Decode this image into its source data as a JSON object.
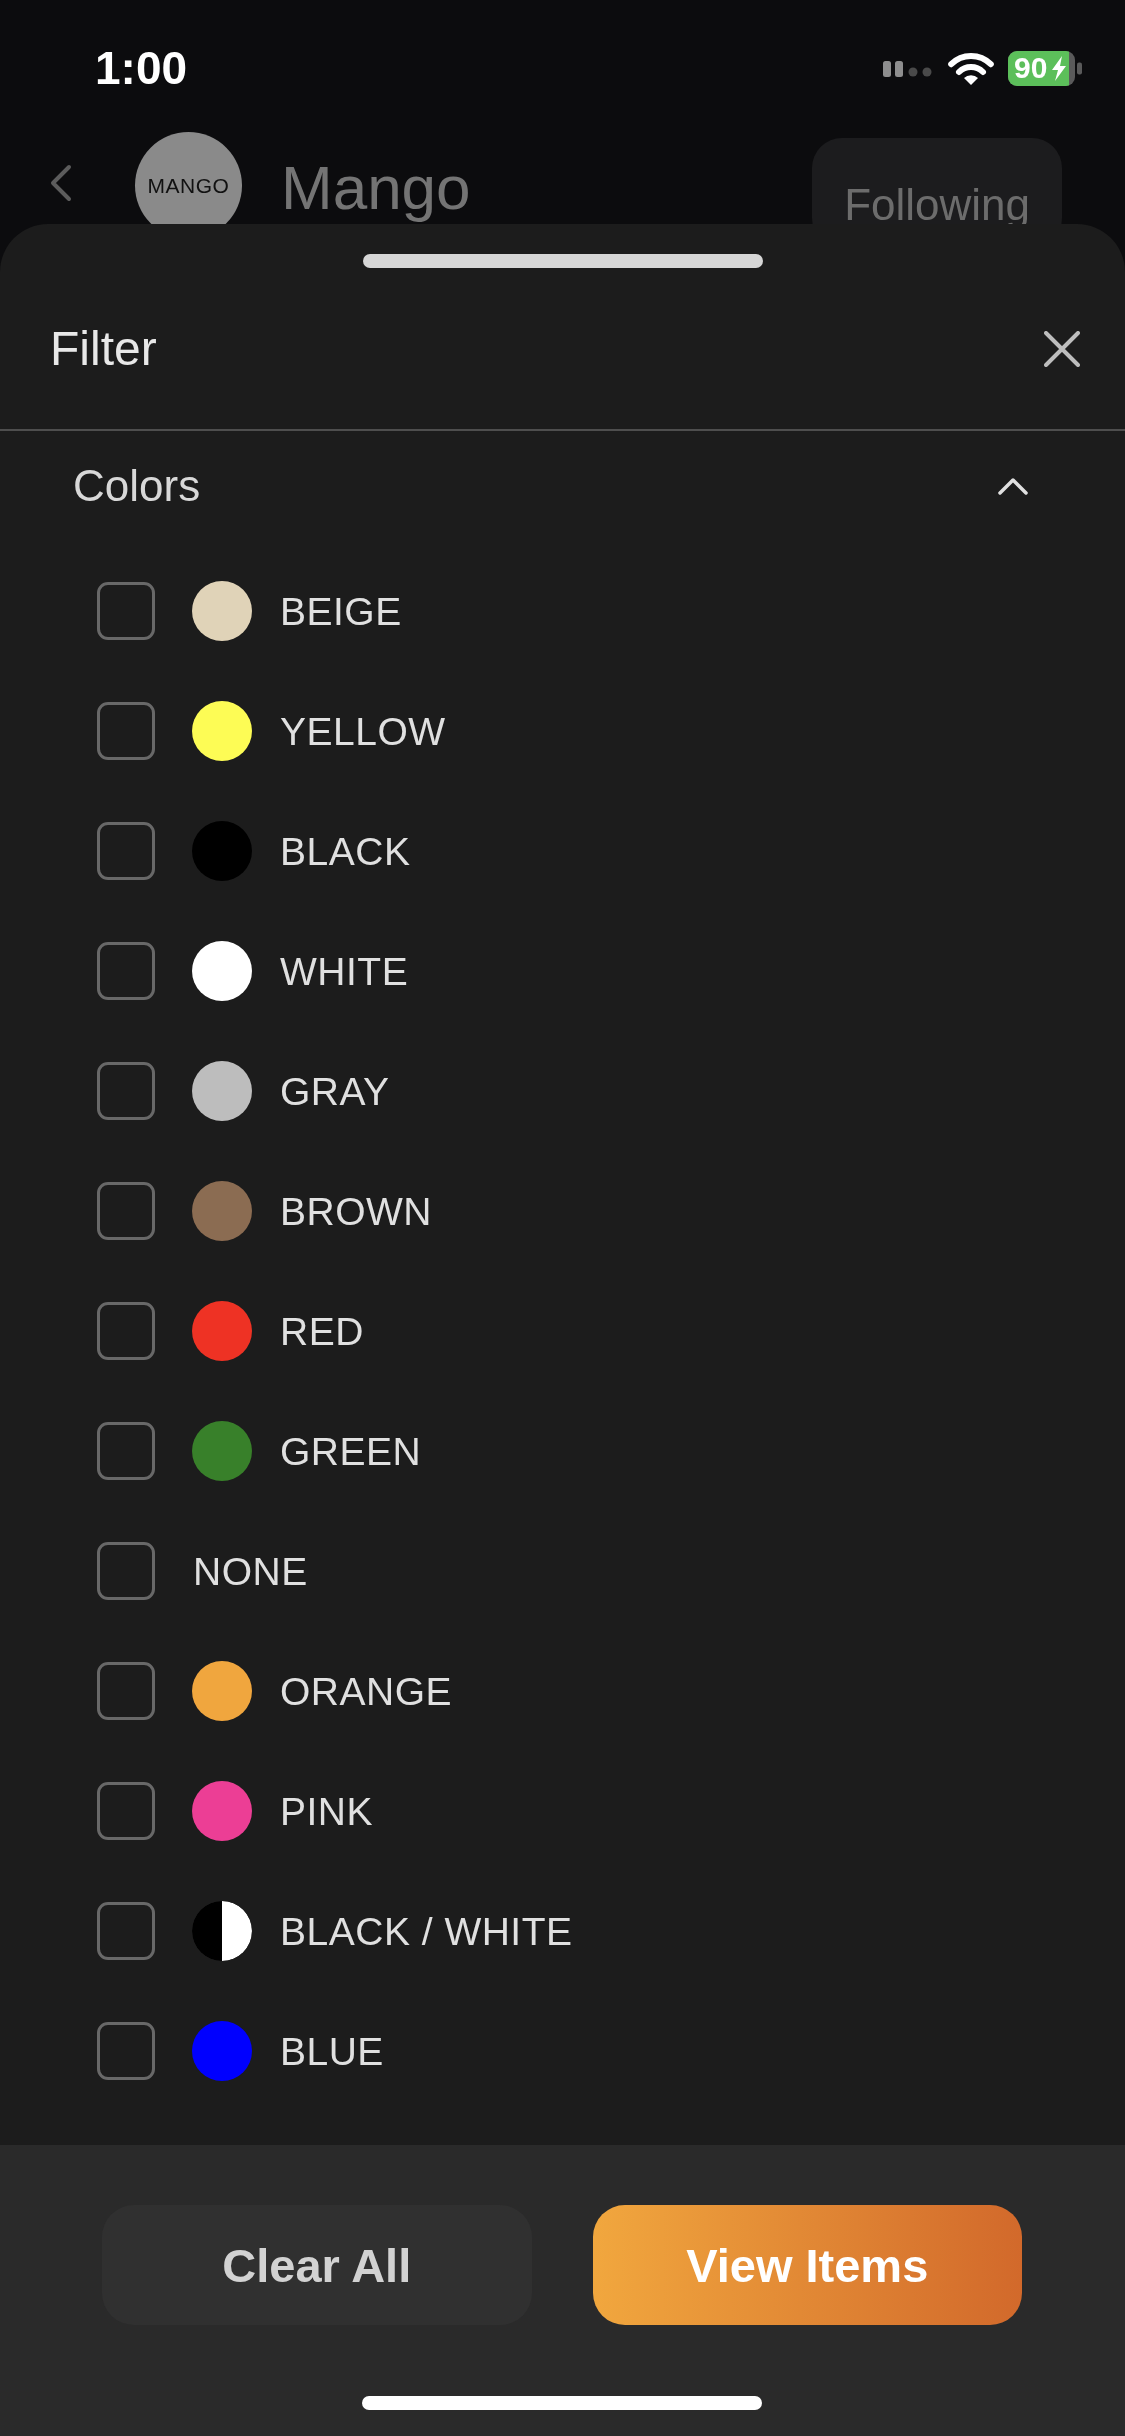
{
  "status_bar": {
    "time": "1:00",
    "battery": "90"
  },
  "header": {
    "logo_text": "MANGO",
    "name": "Mango",
    "follow_button": "Following"
  },
  "sheet": {
    "title": "Filter",
    "section": {
      "title": "Colors",
      "expanded": true,
      "options": [
        {
          "kind": "solid",
          "label": "BEIGE",
          "color": "#e0d3b8",
          "checked": false
        },
        {
          "kind": "solid",
          "label": "YELLOW",
          "color": "#fdfc55",
          "checked": false
        },
        {
          "kind": "solid",
          "label": "BLACK",
          "color": "#000000",
          "checked": false
        },
        {
          "kind": "solid",
          "label": "WHITE",
          "color": "#ffffff",
          "checked": false
        },
        {
          "kind": "solid",
          "label": "GRAY",
          "color": "#bdbdbd",
          "checked": false
        },
        {
          "kind": "solid",
          "label": "BROWN",
          "color": "#8b6c52",
          "checked": false
        },
        {
          "kind": "solid",
          "label": "RED",
          "color": "#ee3224",
          "checked": false
        },
        {
          "kind": "solid",
          "label": "GREEN",
          "color": "#38802a",
          "checked": false
        },
        {
          "kind": "none",
          "label": "NONE",
          "checked": false
        },
        {
          "kind": "solid",
          "label": "ORANGE",
          "color": "#f0a63e",
          "checked": false
        },
        {
          "kind": "solid",
          "label": "PINK",
          "color": "#ec3e95",
          "checked": false
        },
        {
          "kind": "split",
          "label": "BLACK / WHITE",
          "colors": [
            {
              "color": "#000000"
            },
            {
              "color": "#ffffff"
            }
          ],
          "checked": false
        },
        {
          "kind": "solid",
          "label": "BLUE",
          "color": "#0000ff",
          "checked": false
        }
      ]
    }
  },
  "footer": {
    "buttons": [
      {
        "label": "Clear All",
        "kind": "secondary"
      },
      {
        "label": "View Items",
        "kind": "primary"
      }
    ]
  }
}
